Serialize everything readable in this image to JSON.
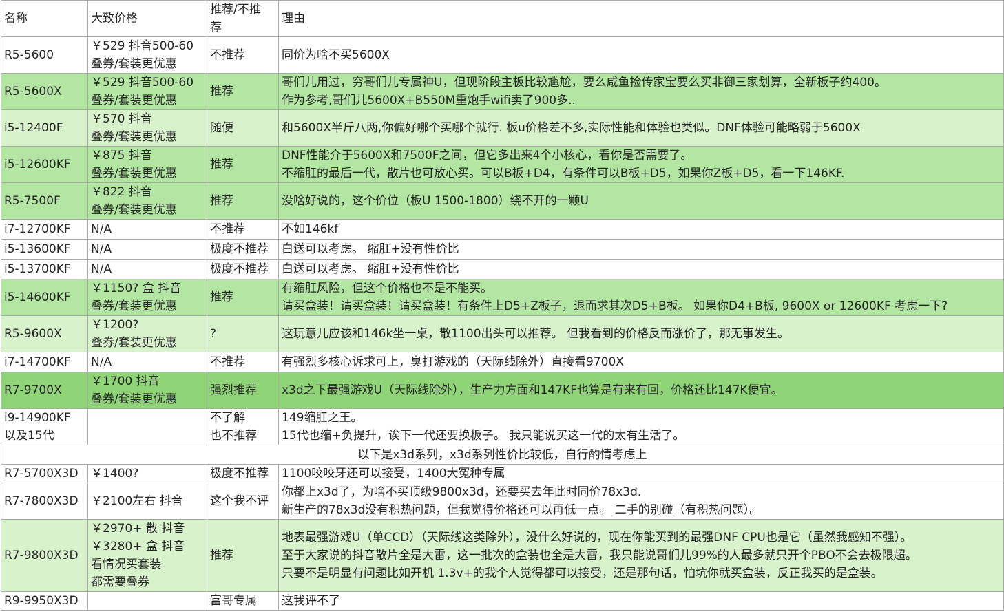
{
  "header": {
    "name": "名称",
    "price": "大致价格",
    "rec": "推荐/不推荐",
    "reason": "理由"
  },
  "rows": [
    {
      "name": "R5-5600",
      "price": [
        "￥529 抖音500-60",
        "叠券/套装更优惠"
      ],
      "rec": [
        "不推荐"
      ],
      "reason": [
        "同价为啥不买5600X"
      ]
    },
    {
      "name": "R5-5600X",
      "price": [
        "￥529 抖音500-60",
        "叠券/套装更优惠"
      ],
      "rec": [
        "推荐"
      ],
      "reason": [
        "哥们儿用过，穷哥们儿专属神U，但现阶段主板比较尴尬，要么咸鱼捡传家宝要么买非御三家划算，全新板子约400。",
        "作为参考,哥们儿5600X+B550M重炮手wifi卖了900多.."
      ]
    },
    {
      "name": "i5-12400F",
      "price": [
        "￥570 抖音",
        "叠券/套装更优惠"
      ],
      "rec": [
        "随便"
      ],
      "reason": [
        "和5600X半斤八两,你偏好哪个买哪个就行. 板u价格差不多,实际性能和体验也类似。DNF体验可能略弱于5600X"
      ]
    },
    {
      "name": "i5-12600KF",
      "price": [
        "￥875 抖音",
        "叠券/套装更优惠"
      ],
      "rec": [
        "推荐"
      ],
      "reason": [
        "DNF性能介于5600X和7500F之间，但它多出来4个小核心，看你是否需要了。",
        "不缩肛的最后一代，散片也可放心买。可以B板+D4，有条件可以B板+D5，如果你Z板+D5，看一下146KF."
      ]
    },
    {
      "name": "R5-7500F",
      "price": [
        "￥822 抖音",
        "叠券/套装更优惠"
      ],
      "rec": [
        "推荐"
      ],
      "reason": [
        "没啥好说的，这个价位（板U 1500-1800）绕不开的一颗U"
      ]
    },
    {
      "name": "i7-12700KF",
      "price": [
        "N/A"
      ],
      "rec": [
        "不推荐"
      ],
      "reason": [
        "不如146kf"
      ]
    },
    {
      "name": "i5-13600KF",
      "price": [
        "N/A"
      ],
      "rec": [
        "极度不推荐"
      ],
      "reason": [
        "白送可以考虑。 缩肛+没有性价比"
      ]
    },
    {
      "name": "i5-13700KF",
      "price": [
        "N/A"
      ],
      "rec": [
        "极度不推荐"
      ],
      "reason": [
        "白送可以考虑。 缩肛+没有性价比"
      ]
    },
    {
      "name": "i5-14600KF",
      "price": [
        "￥1150?  盒 抖音",
        "叠券/套装更优惠"
      ],
      "rec": [
        "推荐"
      ],
      "reason": [
        "有缩肛风险，但这个价格也不是不能买。",
        "请买盒装！请买盒装！请买盒装！有条件上D5+Z板子，退而求其次D5+B板。 如果你D4+B板, 9600X or 12600KF 考虑一下?"
      ]
    },
    {
      "name": "R5-9600X",
      "price": [
        "￥1200?",
        "叠券/套装更优惠"
      ],
      "rec": [
        "?"
      ],
      "reason": [
        "这玩意儿应该和146k坐一桌，散1100出头可以推荐。 但我看到的价格反而涨价了，那无事发生。"
      ]
    },
    {
      "name": "i7-14700KF",
      "price": [
        "N/A"
      ],
      "rec": [
        "不推荐"
      ],
      "reason": [
        "有强烈多核心诉求可上，臭打游戏的（天际线除外）直接看9700X"
      ]
    },
    {
      "name": "R7-9700X",
      "price": [
        "￥1700 抖音",
        "叠券/套装更优惠"
      ],
      "rec": [
        "强烈推荐"
      ],
      "reason": [
        "x3d之下最强游戏U（天际线除外），生产力方面和147KF也算是有来有回，价格还比147K便宜。"
      ]
    },
    {
      "name": [
        "i9-14900KF",
        "以及15代"
      ],
      "price": [
        ""
      ],
      "rec": [
        "不了解",
        "也不推荐"
      ],
      "reason": [
        "149缩肛之王。",
        "15代也缩+负提升，诶下一代还要换板子。 我只能说买这一代的太有生活了。"
      ]
    },
    {
      "section": "以下是x3d系列，x3d系列性价比较低，自行酌情考虑上"
    },
    {
      "name": "R7-5700X3D",
      "price": [
        "￥1400?"
      ],
      "rec": [
        "极度不推荐"
      ],
      "reason": [
        "1100咬咬牙还可以接受，1400大冤种专属"
      ]
    },
    {
      "name": "R7-7800X3D",
      "price": [
        "￥2100左右 抖音"
      ],
      "rec": [
        "这个我不评"
      ],
      "reason": [
        "你都上x3d了，为啥不买顶级9800x3d，还要买去年此时同价78x3d.",
        "新生产的78x3d没有积热问题，但我觉得价格还可以再低一点。 二手的别碰（有积热问题）。"
      ]
    },
    {
      "name": "R7-9800X3D",
      "price": [
        "￥2970+ 散 抖音",
        "￥3280+ 盒 抖音",
        "看情况买套装",
        "都需要叠券"
      ],
      "rec": [
        "推荐"
      ],
      "reason": [
        "地表最强游戏U（单CCD）（天际线这类除外），没什么好说的，现在你能买到的最强DNF CPU也是它（虽然我感知不强）。",
        "至于大家说的抖音散片全是大雷，这一批次的盒装也全是大雷，我只能说哥们儿99%的人最多就只开个PBO不会去极限超。",
        "只要不是明显有问题比如开机 1.3v+的我个人觉得都可以接受，还是那句话，怕坑你就买盒装，反正我买的是盒装。"
      ]
    },
    {
      "name": "R9-9950X3D",
      "price": [
        ""
      ],
      "rec": [
        "富哥专属"
      ],
      "reason": [
        "这我评不了"
      ]
    }
  ]
}
